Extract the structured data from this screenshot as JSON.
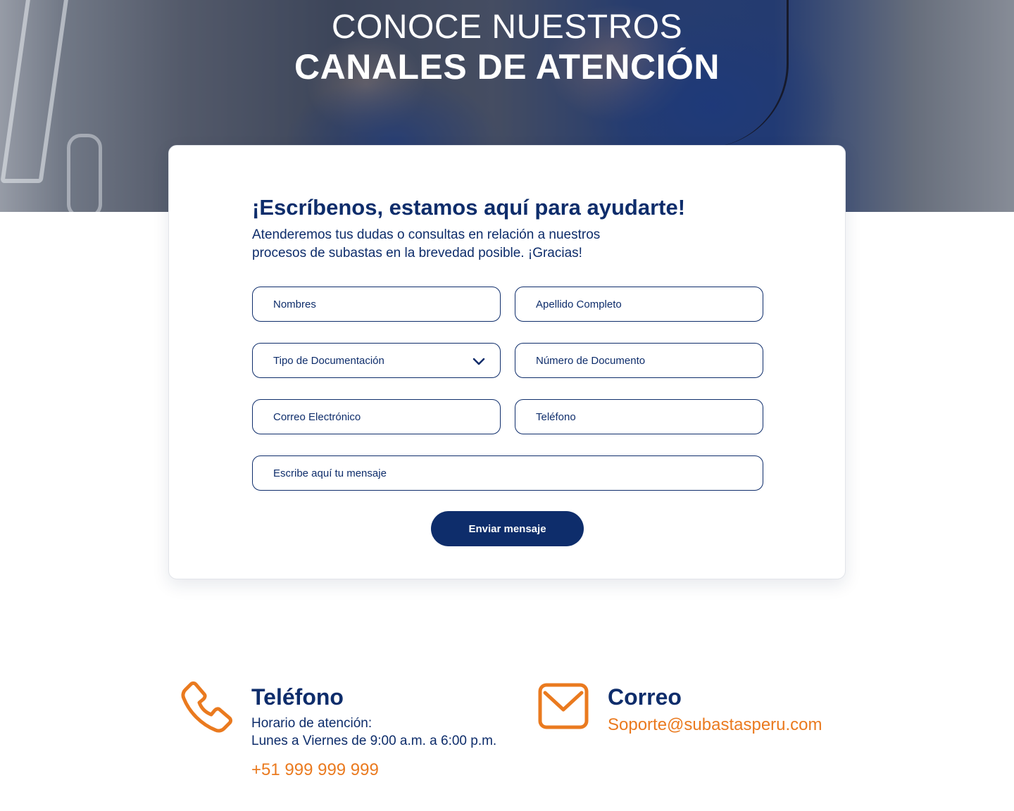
{
  "hero": {
    "title_line1": "CONOCE NUESTROS",
    "title_line2": "CANALES DE ATENCIÓN"
  },
  "form": {
    "title": "¡Escríbenos, estamos aquí para ayudarte!",
    "subtitle": "Atenderemos tus dudas o consultas en relación a nuestros procesos de subastas en la brevedad posible. ¡Gracias!",
    "fields": {
      "nombres": "Nombres",
      "apellido": "Apellido Completo",
      "tipo_documento": "Tipo de Documentación",
      "numero_documento": "Número de Documento",
      "correo": "Correo Electrónico",
      "telefono": "Teléfono",
      "mensaje": "Escribe aquí tu mensaje"
    },
    "submit_label": "Enviar mensaje"
  },
  "contact": {
    "phone": {
      "icon": "phone-icon",
      "title": "Teléfono",
      "hours_label": "Horario de atención:",
      "hours": "Lunes a Viernes de 9:00 a.m. a 6:00 p.m.",
      "number": "+51 999 999 999"
    },
    "email": {
      "icon": "mail-icon",
      "title": "Correo",
      "address": "Soporte@subastasperu.com"
    }
  },
  "colors": {
    "primary": "#0e2d6b",
    "accent": "#ea7a1f",
    "background": "#ffffff"
  }
}
